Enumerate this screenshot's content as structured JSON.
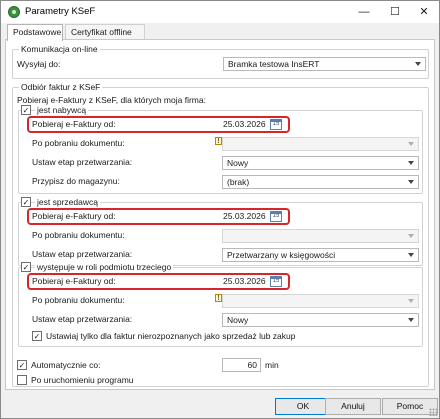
{
  "window": {
    "title": "Parametry KSeF",
    "minimize_glyph": "—",
    "maximize_glyph": "☐",
    "close_glyph": "✕"
  },
  "tabs": [
    {
      "label": "Podstawowe",
      "active": true
    },
    {
      "label": "Certyfikat offline",
      "active": false
    }
  ],
  "komunikacja": {
    "legend": "Komunikacja on-line",
    "send_label": "Wysyłaj do:",
    "send_value": "Bramka testowa InsERT"
  },
  "odbior": {
    "legend": "Odbiór faktur z KSeF",
    "intro": "Pobieraj e-Faktury z KSeF, dla których moja firma:",
    "nabywca": {
      "checkbox_label": "jest nabywcą",
      "checked": true,
      "date_label": "Pobieraj e-Faktury od:",
      "date_value": "25.03.2026",
      "after_label": "Po pobraniu dokumentu:",
      "after_value": "",
      "stage_label": "Ustaw etap przetwarzania:",
      "stage_value": "Nowy",
      "warehouse_label": "Przypisz do magazynu:",
      "warehouse_value": "(brak)"
    },
    "sprzedawca": {
      "checkbox_label": "jest sprzedawcą",
      "checked": true,
      "date_label": "Pobieraj e-Faktury od:",
      "date_value": "25.03.2026",
      "after_label": "Po pobraniu dokumentu:",
      "after_value": "",
      "stage_label": "Ustaw etap przetwarzania:",
      "stage_value": "Przetwarzany w księgowości"
    },
    "podmiot_trzeci": {
      "checkbox_label": "występuje w roli podmiotu trzeciego",
      "checked": true,
      "date_label": "Pobieraj e-Faktury od:",
      "date_value": "25.03.2026",
      "after_label": "Po pobraniu dokumentu:",
      "after_value": "",
      "stage_label": "Ustaw etap przetwarzania:",
      "stage_value": "Nowy",
      "unrecognized_label": "Ustawiaj tylko dla faktur nierozpoznanych jako sprzedaż lub zakup",
      "unrecognized_checked": true
    },
    "auto_label": "Automatycznie co:",
    "auto_checked": true,
    "auto_value": "60",
    "auto_unit": "min",
    "startup_label": "Po uruchomieniu programu",
    "startup_checked": false
  },
  "buttons": {
    "ok": "OK",
    "cancel": "Anuluj",
    "help": "Pomoc"
  },
  "icons": {
    "calendar_glyph": "15",
    "checkmark_glyph": "✓",
    "warning_glyph": "!"
  },
  "colors": {
    "highlight": "#d7262b",
    "default_button_border": "#0078d7"
  }
}
